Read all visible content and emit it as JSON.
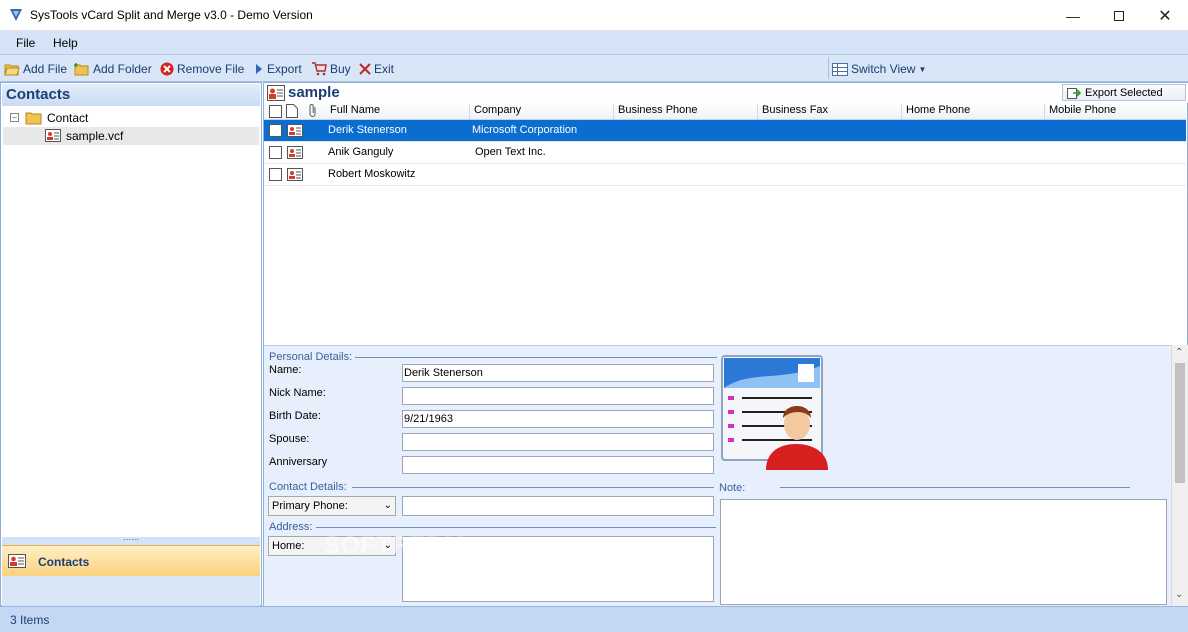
{
  "window": {
    "title": "SysTools vCard Split and Merge v3.0 - Demo Version"
  },
  "menu": {
    "items": [
      "File",
      "Help"
    ]
  },
  "toolbar": {
    "add_file": "Add File",
    "add_folder": "Add Folder",
    "remove_file": "Remove File",
    "export": "Export",
    "buy": "Buy",
    "exit": "Exit",
    "switch_view": "Switch View"
  },
  "left_pane": {
    "header": "Contacts",
    "tree": {
      "root": "Contact",
      "child": "sample.vcf"
    },
    "bottom_tab": "Contacts"
  },
  "right_pane": {
    "folder_title": "sample",
    "export_selected": "Export Selected",
    "columns": [
      "Full Name",
      "Company",
      "Business Phone",
      "Business Fax",
      "Home Phone",
      "Mobile Phone"
    ],
    "rows": [
      {
        "full_name": "Derik Stenerson",
        "company": "Microsoft Corporation",
        "selected": true
      },
      {
        "full_name": "Anik Ganguly",
        "company": "Open Text Inc.",
        "selected": false
      },
      {
        "full_name": "Robert Moskowitz",
        "company": "",
        "selected": false
      }
    ]
  },
  "details": {
    "personal_section": "Personal Details:",
    "name_label": "Name:",
    "name_value": "Derik Stenerson",
    "nickname_label": "Nick Name:",
    "nickname_value": "",
    "birthdate_label": "Birth Date:",
    "birthdate_value": "9/21/1963",
    "spouse_label": "Spouse:",
    "spouse_value": "",
    "anniversary_label": "Anniversary",
    "anniversary_value": "",
    "contact_section": "Contact Details:",
    "primary_phone_option": "Primary Phone:",
    "primary_phone_value": "",
    "address_section": "Address:",
    "address_option": "Home:",
    "note_label": "Note:",
    "note_value": ""
  },
  "status": {
    "items_count": "3 Items"
  },
  "watermark": "SOFTPEDIA",
  "colors": {
    "accent": "#0a6ed1",
    "header_blue": "#1b3e73",
    "toolbar_bg": "#d8e6f8",
    "tab_orange": "#fbd27d"
  }
}
